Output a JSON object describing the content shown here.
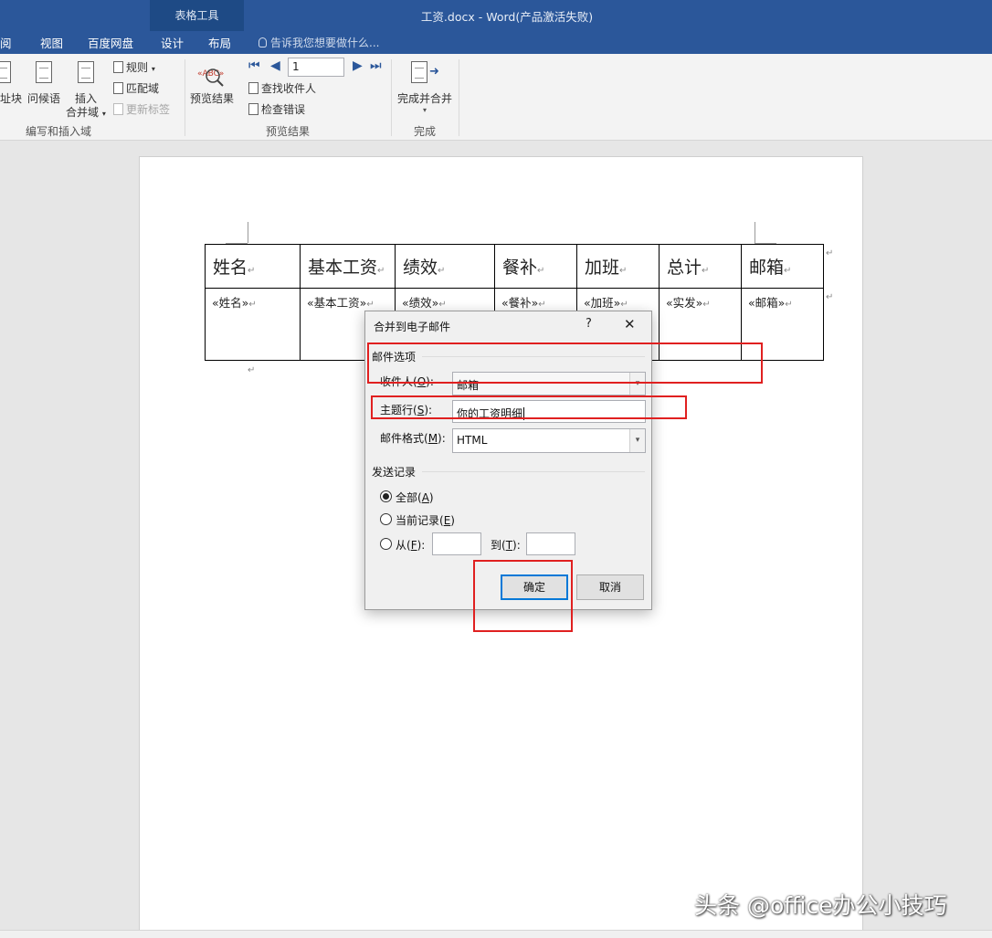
{
  "window": {
    "context_tab_group": "表格工具",
    "title": "工资.docx - Word(产品激活失败)"
  },
  "tabs": [
    "阅",
    "视图",
    "百度网盘",
    "设计",
    "布局"
  ],
  "tell_me": "告诉我您想要做什么...",
  "ribbon": {
    "write_insert": {
      "address_block": "址块",
      "greeting": "问候语",
      "insert_field_l1": "插入",
      "insert_field_l2": "合并域",
      "rules": "规则",
      "match_fields": "匹配域",
      "update_labels": "更新标签",
      "group_label": "编写和插入域"
    },
    "preview": {
      "preview_results": "预览结果",
      "record_number": "1",
      "find_recipient": "查找收件人",
      "check_errors": "检查错误",
      "group_label": "预览结果"
    },
    "finish": {
      "finish_merge": "完成并合并",
      "group_label": "完成"
    }
  },
  "table": {
    "headers": [
      "姓名",
      "基本工资",
      "绩效",
      "餐补",
      "加班",
      "总计",
      "邮箱"
    ],
    "fields": [
      "«姓名»",
      "«基本工资»",
      "«绩效»",
      "«餐补»",
      "«加班»",
      "«实发»",
      "«邮箱»"
    ]
  },
  "dialog": {
    "title": "合并到电子邮件",
    "help": "?",
    "close": "✕",
    "mail_options_label": "邮件选项",
    "to_label": "收件人(O):",
    "to_value": "邮箱",
    "subject_label": "主题行(S):",
    "subject_value": "你的工资明细",
    "format_label": "邮件格式(M):",
    "format_value": "HTML",
    "send_records_label": "发送记录",
    "all_label": "全部(A)",
    "current_label": "当前记录(E)",
    "from_label": "从(F):",
    "to_range_label": "到(T):",
    "ok": "确定",
    "cancel": "取消"
  },
  "watermark": "头条 @office办公小技巧"
}
